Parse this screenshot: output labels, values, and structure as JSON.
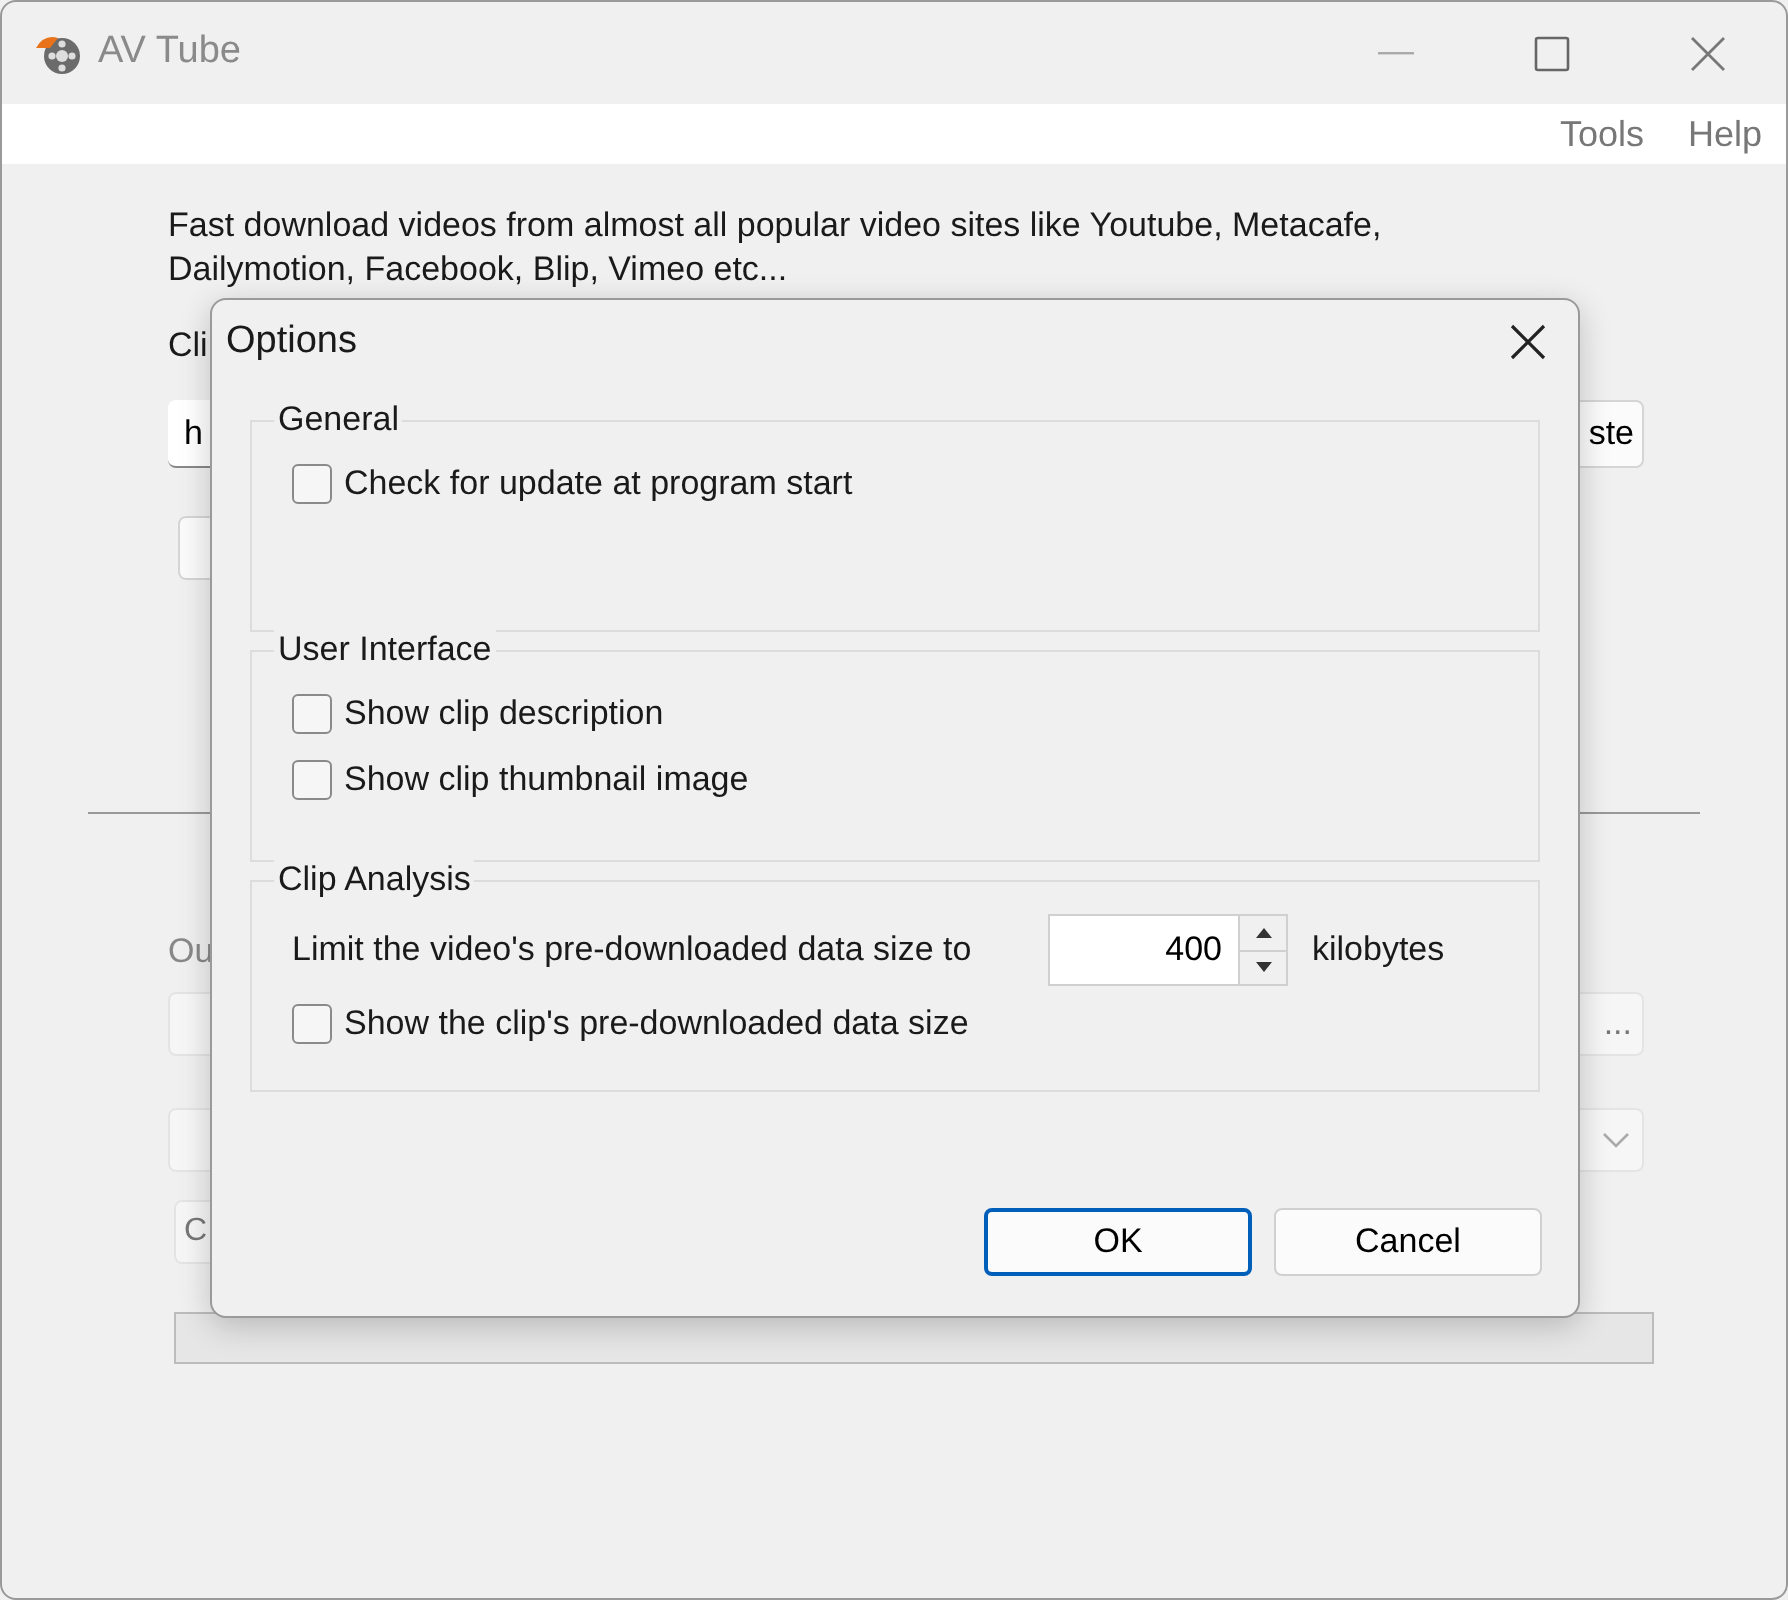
{
  "window": {
    "title": "AV Tube"
  },
  "menu": [
    "Tools",
    "Help"
  ],
  "main": {
    "description": "Fast download videos from almost all popular video sites like Youtube, Metacafe, Dailymotion, Facebook, Blip, Vimeo etc...",
    "clip_label": "Cli",
    "url_value": "h",
    "paste_button": "ste",
    "output_label": "Ou",
    "browse_button": "...",
    "start_button": "C",
    "progress": {
      "level": 0
    }
  },
  "dialog": {
    "title": "Options",
    "groups": [
      {
        "title": "General",
        "rows": [
          {
            "kind": "checkbox",
            "label": "Check for update at program start",
            "checked": false
          }
        ]
      },
      {
        "title": "User Interface",
        "rows": [
          {
            "kind": "checkbox",
            "label": "Show clip description",
            "checked": false
          },
          {
            "kind": "checkbox",
            "label": "Show clip thumbnail image",
            "checked": false
          }
        ]
      },
      {
        "title": "Clip Analysis",
        "rows": [
          {
            "kind": "spin",
            "label": "Limit the video's pre-downloaded data size to",
            "value": "400",
            "unit": "kilobytes"
          },
          {
            "kind": "checkbox",
            "label": "Show the clip's pre-downloaded data size",
            "checked": false
          }
        ]
      }
    ],
    "buttons": [
      {
        "label": "OK",
        "default": true
      },
      {
        "label": "Cancel",
        "default": false
      }
    ]
  }
}
